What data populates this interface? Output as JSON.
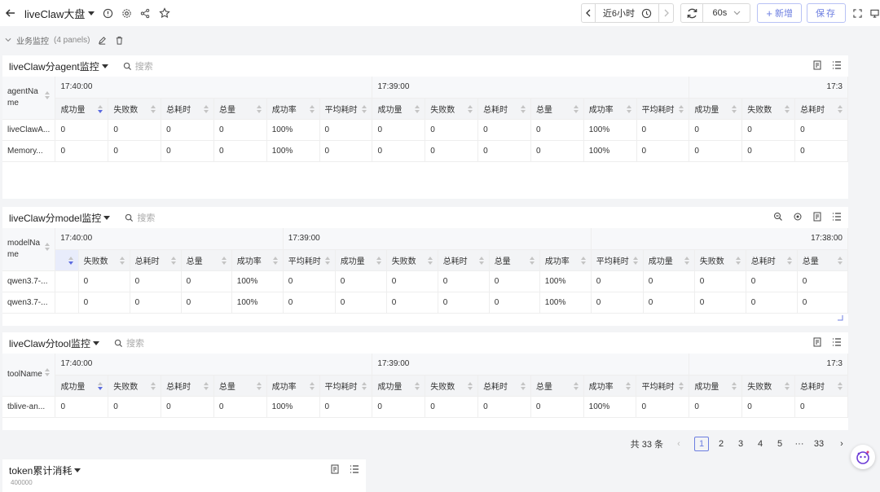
{
  "header": {
    "title": "liveClaw大盘",
    "time_range": "近6小时",
    "refresh_interval": "60s",
    "add_label": "新增",
    "save_label": "保存"
  },
  "group": {
    "name": "业务监控",
    "panel_count": "(4 panels)"
  },
  "panels": [
    {
      "title": "liveClaw分agent监控",
      "search_placeholder": "搜索",
      "dim_header": "agentName",
      "time_groups": [
        "17:40:00",
        "17:39:00",
        "17:3"
      ],
      "columns": [
        "成功量",
        "失败数",
        "总耗时",
        "总量",
        "成功率",
        "平均耗时",
        "成功量",
        "失败数",
        "总耗时",
        "总量",
        "成功率",
        "平均耗时",
        "成功量",
        "失败数",
        "总耗时"
      ],
      "rows": [
        {
          "name": "liveClawA...",
          "values": [
            "0",
            "0",
            "0",
            "0",
            "100%",
            "0",
            "0",
            "0",
            "0",
            "0",
            "100%",
            "0",
            "0",
            "0",
            "0"
          ]
        },
        {
          "name": "Memory...",
          "values": [
            "0",
            "0",
            "0",
            "0",
            "100%",
            "0",
            "0",
            "0",
            "0",
            "0",
            "100%",
            "0",
            "0",
            "0",
            "0"
          ]
        }
      ]
    },
    {
      "title": "liveClaw分model监控",
      "search_placeholder": "搜索",
      "dim_header": "modelName",
      "time_groups": [
        "17:40:00",
        "17:39:00",
        "17:38:00"
      ],
      "columns": [
        "",
        "失败数",
        "总耗时",
        "总量",
        "成功率",
        "平均耗时",
        "成功量",
        "失败数",
        "总耗时",
        "总量",
        "成功率",
        "平均耗时",
        "成功量",
        "失败数",
        "总耗时",
        "总量"
      ],
      "rows": [
        {
          "name": "qwen3.7-...",
          "values": [
            "",
            "0",
            "0",
            "0",
            "100%",
            "0",
            "0",
            "0",
            "0",
            "0",
            "100%",
            "0",
            "0",
            "0",
            "0",
            "0"
          ]
        },
        {
          "name": "qwen3.7-...",
          "values": [
            "",
            "0",
            "0",
            "0",
            "100%",
            "0",
            "0",
            "0",
            "0",
            "0",
            "100%",
            "0",
            "0",
            "0",
            "0",
            "0"
          ]
        }
      ]
    },
    {
      "title": "liveClaw分tool监控",
      "search_placeholder": "搜索",
      "dim_header": "toolName",
      "time_groups": [
        "17:40:00",
        "17:39:00",
        "17:3"
      ],
      "columns": [
        "成功量",
        "失败数",
        "总耗时",
        "总量",
        "成功率",
        "平均耗时",
        "成功量",
        "失败数",
        "总耗时",
        "总量",
        "成功率",
        "平均耗时",
        "成功量",
        "失败数",
        "总耗时"
      ],
      "rows": [
        {
          "name": "tblive-an...",
          "values": [
            "0",
            "0",
            "0",
            "0",
            "100%",
            "0",
            "0",
            "0",
            "0",
            "0",
            "100%",
            "0",
            "0",
            "0",
            "0"
          ]
        }
      ]
    }
  ],
  "pagination": {
    "total": "共 33 条",
    "pages": [
      "1",
      "2",
      "3",
      "4",
      "5",
      "···",
      "33"
    ],
    "current": "1"
  },
  "token_panel": {
    "title": "token累计消耗",
    "y_tick": "400000"
  }
}
